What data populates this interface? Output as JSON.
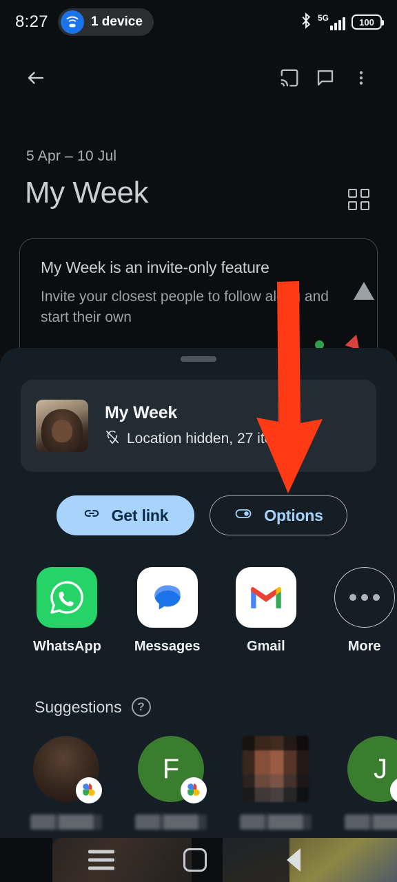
{
  "status_bar": {
    "clock": "8:27",
    "hotspot_label": "1 device",
    "hotspot_icon": "wifi-tethering-icon",
    "bluetooth_icon": "bluetooth-icon",
    "network_label": "5G",
    "signal_icon": "cellular-signal-icon",
    "battery_level": "100"
  },
  "app_bar": {
    "back_icon": "back-arrow-icon",
    "cast_icon": "cast-icon",
    "comment_icon": "comment-icon",
    "overflow_icon": "more-vert-icon"
  },
  "header": {
    "date_range": "5 Apr – 10 Jul",
    "title": "My Week",
    "grid_icon": "grid-view-icon"
  },
  "invite_card": {
    "title": "My Week is an invite-only feature",
    "subtitle": "Invite your closest people to follow along and start their own"
  },
  "share_sheet": {
    "handle": "drag-handle",
    "preview": {
      "title": "My Week",
      "meta": "Location hidden, 27 items",
      "meta_icon": "location-off-icon",
      "thumbnail": "selfie-thumbnail"
    },
    "actions": [
      {
        "label": "Get link",
        "icon": "link-icon",
        "style": "filled"
      },
      {
        "label": "Options",
        "icon": "toggle-icon",
        "style": "outlined"
      }
    ],
    "apps": [
      {
        "label": "WhatsApp",
        "icon": "whatsapp-icon"
      },
      {
        "label": "Messages",
        "icon": "messages-icon"
      },
      {
        "label": "Gmail",
        "icon": "gmail-icon"
      },
      {
        "label": "More",
        "icon": "more-horiz-icon"
      }
    ],
    "suggestions": {
      "title": "Suggestions",
      "help_icon": "help-circle-icon",
      "items": [
        {
          "avatar_type": "photo",
          "initial": "",
          "name": "",
          "badge": "google-photos-badge"
        },
        {
          "avatar_type": "initial",
          "initial": "F",
          "name": "",
          "badge": "google-photos-badge"
        },
        {
          "avatar_type": "blurred",
          "initial": "",
          "name": "",
          "badge": ""
        },
        {
          "avatar_type": "initial",
          "initial": "J",
          "name": "",
          "badge": "google-photos-badge"
        }
      ]
    }
  },
  "annotation": {
    "arrow_color": "#FF3A14",
    "points_to": "Options"
  },
  "nav_bar": {
    "recents_icon": "recents-icon",
    "home_icon": "home-icon",
    "back_icon": "nav-back-icon"
  },
  "colors": {
    "background": "#0a0e11",
    "sheet": "#151d25",
    "accent_blue": "#a8d3fb",
    "annotation_red": "#FF3A14"
  }
}
